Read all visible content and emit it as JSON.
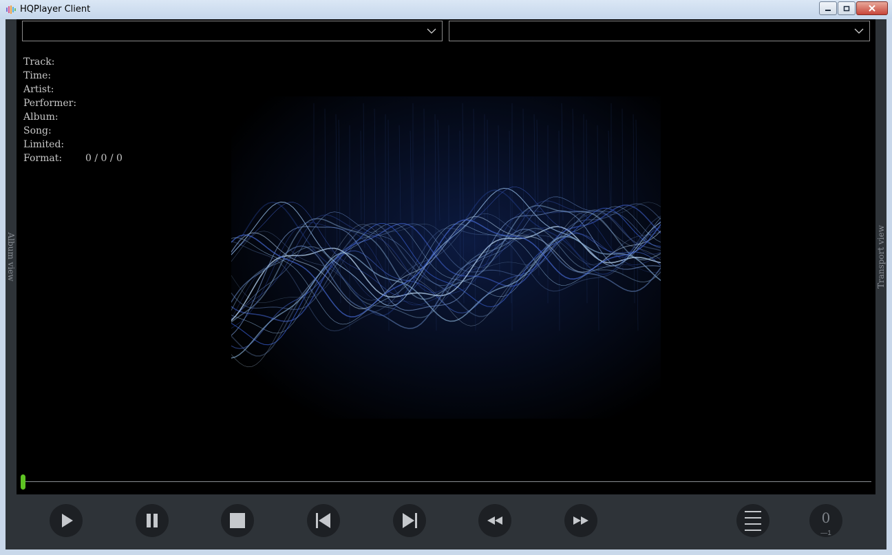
{
  "window": {
    "title": "HQPlayer Client"
  },
  "dropdowns": {
    "left_value": "",
    "right_value": ""
  },
  "side_panels": {
    "left_label": "Album view",
    "right_label": "Transport view"
  },
  "track_info": [
    {
      "label": "Track:",
      "value": ""
    },
    {
      "label": "Time:",
      "value": ""
    },
    {
      "label": "Artist:",
      "value": ""
    },
    {
      "label": "Performer:",
      "value": ""
    },
    {
      "label": "Album:",
      "value": ""
    },
    {
      "label": "Song:",
      "value": ""
    },
    {
      "label": "Limited:",
      "value": ""
    },
    {
      "label": "Format:",
      "value": "0 / 0 / 0"
    }
  ],
  "seek": {
    "position": 0
  },
  "volume": {
    "value": "0",
    "sub": "—1"
  },
  "colors": {
    "seek_handle": "#5ec323",
    "transport_bg": "#2e3338",
    "button_bg": "#1d2024",
    "icon": "#c5c8cc"
  },
  "icons": {
    "play": "play-icon",
    "pause": "pause-icon",
    "stop": "stop-icon",
    "previous": "skip-previous-icon",
    "next": "skip-next-icon",
    "rewind": "rewind-icon",
    "forward": "fast-forward-icon",
    "menu": "menu-icon"
  }
}
